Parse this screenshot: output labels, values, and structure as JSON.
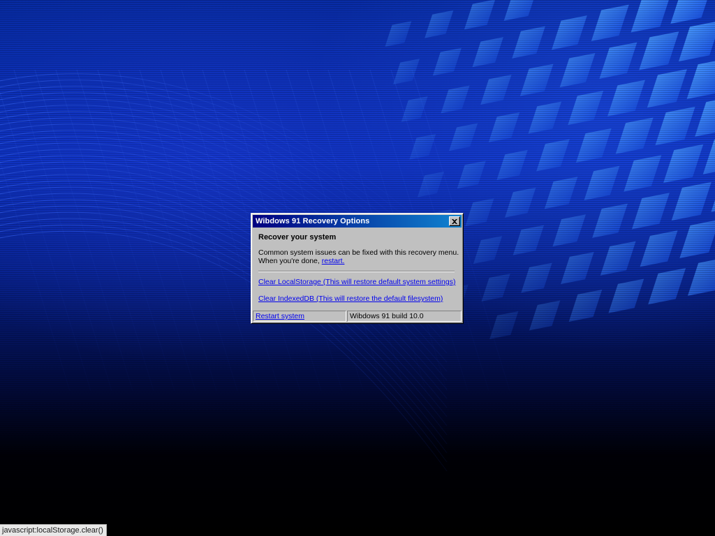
{
  "dialog": {
    "title": "Wibdows 91 Recovery Options",
    "heading": "Recover your system",
    "description_line1": "Common system issues can be fixed with this recovery menu.",
    "description_line2_prefix": "When you're done, ",
    "restart_link": "restart.",
    "actions": [
      {
        "label": "Clear LocalStorage (This will restore default system settings)"
      },
      {
        "label": "Clear IndexedDB (This will restore the default filesystem)"
      }
    ],
    "statusbar": {
      "restart_link": "Restart system",
      "build": "Wibdows 91 build 10.0"
    },
    "close_icon": "close-icon"
  },
  "browser_status": {
    "text": "javascript:localStorage.clear()"
  },
  "colors": {
    "title_start": "#000080",
    "title_end": "#1084d0",
    "window_face": "#c0c0c0",
    "link": "#0000ee",
    "wallpaper_accent": "#2a6cff"
  }
}
